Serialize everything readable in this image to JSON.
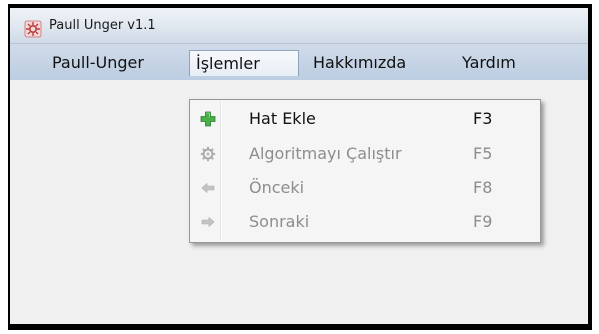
{
  "window": {
    "title": "Paull Unger v1.1"
  },
  "menubar": {
    "items": [
      {
        "label": "Paull-Unger"
      },
      {
        "label": "İşlemler"
      },
      {
        "label": "Hakkımızda"
      },
      {
        "label": "Yardım"
      }
    ]
  },
  "dropdown": {
    "items": [
      {
        "label": "Hat Ekle",
        "shortcut": "F3",
        "icon": "green-plus-icon",
        "enabled": true
      },
      {
        "label": "Algoritmayı Çalıştır",
        "shortcut": "F5",
        "icon": "gear-icon",
        "enabled": false
      },
      {
        "label": "Önceki",
        "shortcut": "F8",
        "icon": "arrow-left-icon",
        "enabled": false
      },
      {
        "label": "Sonraki",
        "shortcut": "F9",
        "icon": "arrow-right-icon",
        "enabled": false
      }
    ]
  },
  "colors": {
    "menubar": "#c6d4e5",
    "titlebar": "#e8edf3",
    "content": "#f0f0f0",
    "disabled_text": "#8d8d8d",
    "accent_green": "#3aa63a"
  }
}
